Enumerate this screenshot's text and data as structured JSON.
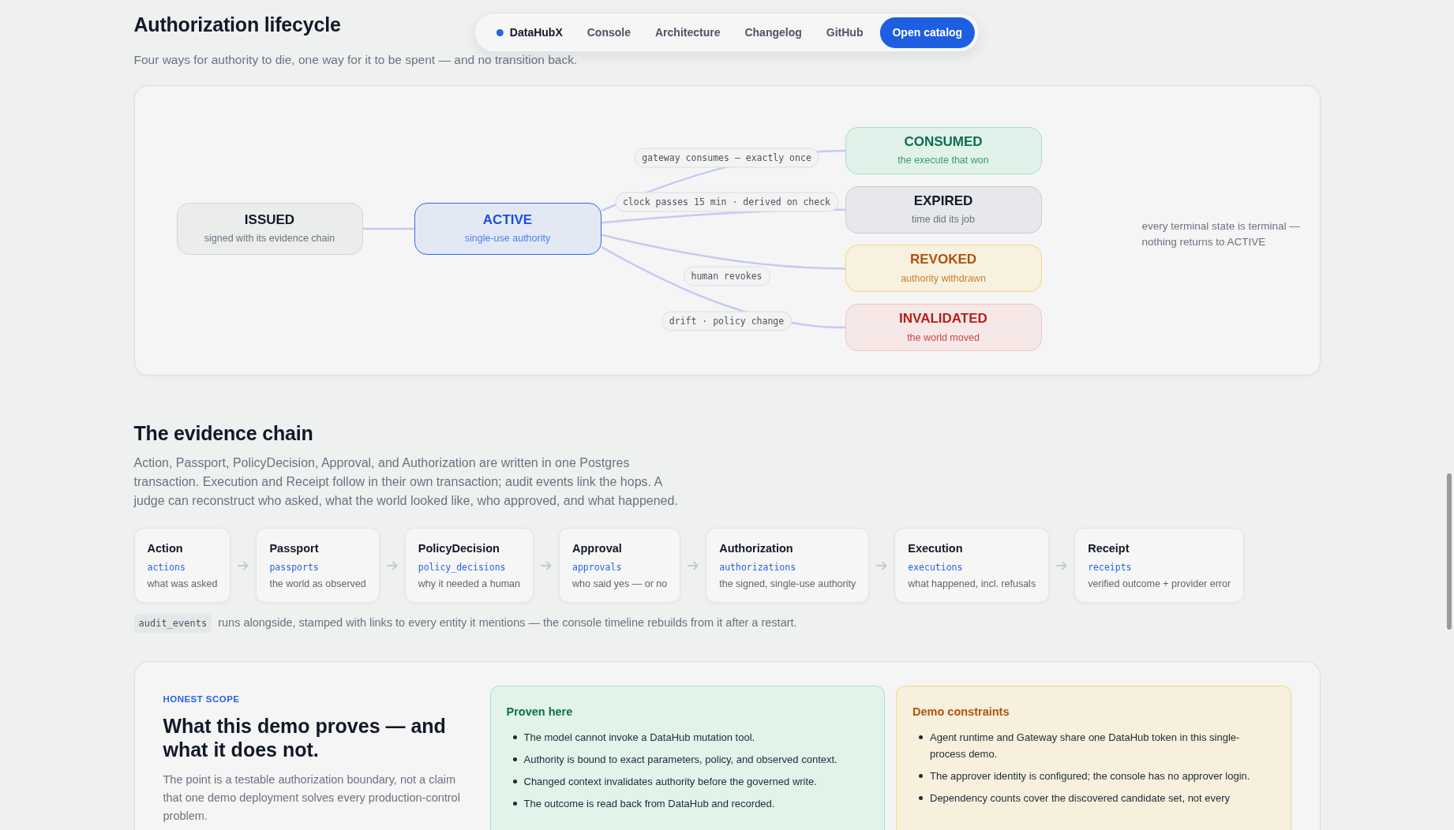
{
  "nav": {
    "brand": "DataHubX",
    "links": [
      {
        "label": "Console"
      },
      {
        "label": "Architecture"
      },
      {
        "label": "Changelog"
      },
      {
        "label": "GitHub"
      }
    ],
    "cta": "Open catalog"
  },
  "lifecycle": {
    "title": "Authorization lifecycle",
    "subtitle": "Four ways for authority to die, one way for it to be spent — and no transition back.",
    "start": {
      "title": "ISSUED",
      "subtitle": "signed with its evidence chain"
    },
    "active": {
      "title": "ACTIVE",
      "subtitle": "single-use authority"
    },
    "terminals": [
      {
        "title": "CONSUMED",
        "subtitle": "the execute that won",
        "kind": "success",
        "via": "gateway consumes — exactly once"
      },
      {
        "title": "EXPIRED",
        "subtitle": "time did its job",
        "kind": "neutral",
        "via": "clock passes 15 min · derived on check"
      },
      {
        "title": "REVOKED",
        "subtitle": "authority withdrawn",
        "kind": "warning",
        "via": "human revokes"
      },
      {
        "title": "INVALIDATED",
        "subtitle": "the world moved",
        "kind": "danger",
        "via": "drift · policy change"
      }
    ],
    "note": "every terminal state is terminal — nothing returns to ACTIVE"
  },
  "evidence": {
    "title": "The evidence chain",
    "body": "Action, Passport, PolicyDecision, Approval, and Authorization are written in one Postgres transaction. Execution and Receipt follow in their own transaction; audit events link the hops. A judge can reconstruct who asked, what the world looked like, who approved, and what happened.",
    "entities": [
      {
        "name": "Action",
        "table": "actions",
        "description": "what was asked"
      },
      {
        "name": "Passport",
        "table": "passports",
        "description": "the world as observed"
      },
      {
        "name": "PolicyDecision",
        "table": "policy_decisions",
        "description": "why it needed a human"
      },
      {
        "name": "Approval",
        "table": "approvals",
        "description": "who said yes — or no"
      },
      {
        "name": "Authorization",
        "table": "authorizations",
        "description": "the signed, single-use authority"
      },
      {
        "name": "Execution",
        "table": "executions",
        "description": "what happened, incl. refusals"
      },
      {
        "name": "Receipt",
        "table": "receipts",
        "description": "verified outcome + provider error"
      }
    ],
    "footnote": {
      "code": "audit_events",
      "text": "runs alongside, stamped with links to every entity it mentions — the console timeline rebuilds from it after a restart."
    }
  },
  "scope": {
    "eyebrow": "HONEST SCOPE",
    "title": "What this demo proves — and what it does not.",
    "body": "The point is a testable authorization boundary, not a claim that one demo deployment solves every production-control problem.",
    "panels": [
      {
        "title": "Proven here",
        "kind": "success",
        "items": [
          "The model cannot invoke a DataHub mutation tool.",
          "Authority is bound to exact parameters, policy, and observed context.",
          "Changed context invalidates authority before the governed write.",
          "The outcome is read back from DataHub and recorded."
        ]
      },
      {
        "title": "Demo constraints",
        "kind": "warning",
        "items": [
          "Agent runtime and Gateway share one DataHub token in this single-process demo.",
          "The approver identity is configured; the console has no approver login.",
          "Dependency counts cover the discovered candidate set, not every"
        ]
      }
    ]
  }
}
